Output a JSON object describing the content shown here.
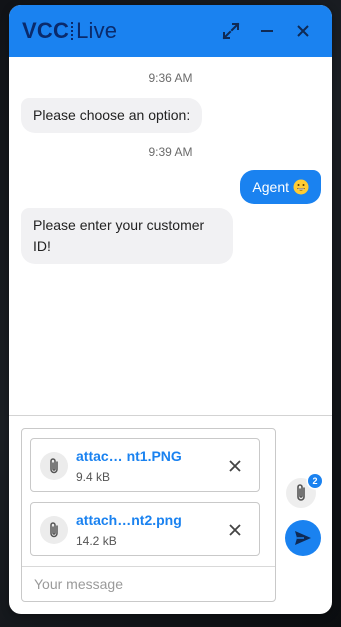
{
  "header": {
    "brand_bold": "VCC",
    "brand_light": "Live",
    "background": "#1a82f0",
    "buttons": [
      "expand-icon",
      "minimize-icon",
      "close-icon"
    ]
  },
  "messages": [
    {
      "type": "timestamp",
      "text": "9:36 AM"
    },
    {
      "type": "incoming",
      "text": "Please choose an option:"
    },
    {
      "type": "timestamp",
      "text": "9:39 AM"
    },
    {
      "type": "outgoing",
      "text": "Agent",
      "emoji": "grinning-face-icon"
    },
    {
      "type": "incoming",
      "text": "Please enter your customer ID!"
    }
  ],
  "attachments": [
    {
      "name": "attac… nt1.PNG",
      "size": "9.4 kB"
    },
    {
      "name": "attach…nt2.png",
      "size": "14.2 kB"
    }
  ],
  "composer": {
    "placeholder": "Your message",
    "value": ""
  },
  "attach_badge": "2",
  "colors": {
    "accent": "#1a82f0",
    "bubble_in": "#f1f1f3",
    "brand_text": "#0a2a6b"
  }
}
